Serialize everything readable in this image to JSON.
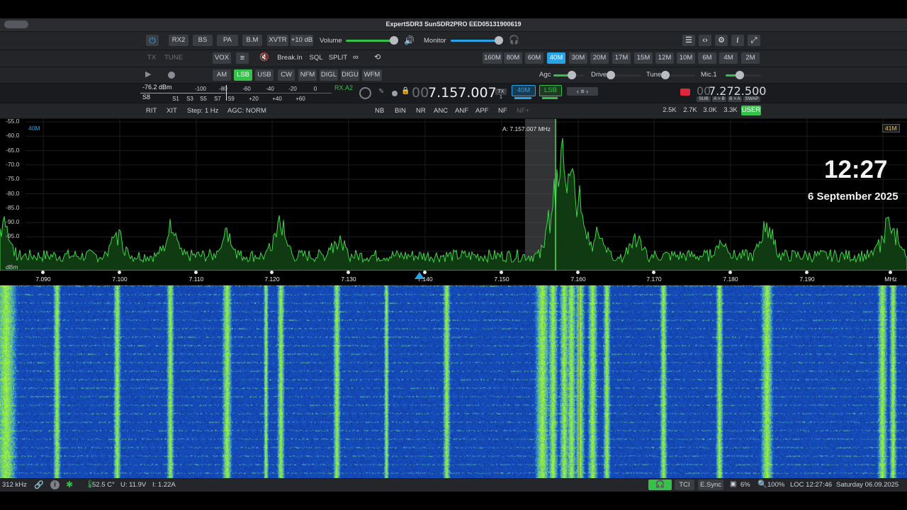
{
  "window": {
    "title": "ExpertSDR3 SunSDR2PRO EED05131900619"
  },
  "toolbar1": {
    "buttons": [
      "RX2",
      "BS",
      "PA",
      "B.M",
      "XVTR",
      "+10 dB"
    ],
    "volume_label": "Volume",
    "monitor_label": "Monitor",
    "volume_level": 0.95,
    "monitor_level": 0.95
  },
  "toolbar2": {
    "left": [
      "TX",
      "TUNE"
    ],
    "mid": [
      "VOX",
      "Break.In",
      "SQL",
      "SPLIT"
    ],
    "bands": [
      "160M",
      "80M",
      "60M",
      "40M",
      "30M",
      "20M",
      "17M",
      "15M",
      "12M",
      "10M",
      "6M",
      "4M",
      "2M"
    ],
    "active_band": "40M"
  },
  "toolbar3": {
    "modes": [
      "AM",
      "LSB",
      "USB",
      "CW",
      "NFM",
      "DIGL",
      "DIGU",
      "WFM"
    ],
    "active_mode": "LSB",
    "agc_label": "Agc",
    "drive_label": "Drive",
    "tune_label": "Tune",
    "mic_label": "Mic.1",
    "agc_level": 0.6,
    "drive_level": 0.0,
    "tune_level": 0.0,
    "mic_level": 0.4
  },
  "meter": {
    "dbm": "-76.2 dBm",
    "s_unit": "S8",
    "top_scale": [
      "-100",
      "-80",
      "-60",
      "-40",
      "-20",
      "0"
    ],
    "bottom_scale": [
      "S1",
      "S3",
      "S5",
      "S7",
      "S9",
      "+20",
      "+40",
      "+60"
    ],
    "rx_label": "RX.A2"
  },
  "vfo_a": {
    "prefix": "00",
    "freq": "7.157.007",
    "tx": "TX",
    "tx_num": "1",
    "band": "40M",
    "mode": "LSB"
  },
  "vfo_b": {
    "prefix": "00",
    "freq": "7.272.500",
    "sub": "SUB",
    "a_b": "A > B",
    "b_a": "B > A",
    "swap": "SWAP"
  },
  "row4": {
    "left": [
      "RIT",
      "XIT",
      "Step: 1 Hz",
      "AGC: NORM"
    ],
    "dsp": [
      "NB",
      "BIN",
      "NR",
      "ANC",
      "ANF",
      "APF",
      "NF",
      "NF+"
    ],
    "filters": [
      "2.5K",
      "2.7K",
      "3.0K",
      "3.3K",
      "USER"
    ],
    "active_filter": "USER"
  },
  "spectrum": {
    "band_left": "40M",
    "band_right": "41M",
    "marker_label": "A: 7.157.007 MHz",
    "db_ticks": [
      "-55.0",
      "-60.0",
      "-65.0",
      "-70.0",
      "-75.0",
      "-80.0",
      "-85.0",
      "-90.0",
      "-95.0",
      "dBm"
    ],
    "freq_ticks": [
      "7.090",
      "7.100",
      "7.110",
      "7.120",
      "7.130",
      "7.140",
      "7.150",
      "7.160",
      "7.170",
      "7.180",
      "7.190",
      "MHz"
    ],
    "clock": "12:27",
    "date": "6 September 2025"
  },
  "status": {
    "bandwidth": "312 kHz",
    "temp": "52.5 C°",
    "voltage": "U: 11.9V",
    "current": "I: 1.22A",
    "tci": "TCI",
    "esync": "E.Sync",
    "cpu": "6%",
    "zoom": "100%",
    "loc_time": "LOC 12:27:46",
    "date": "Saturday 06.09.2025"
  }
}
